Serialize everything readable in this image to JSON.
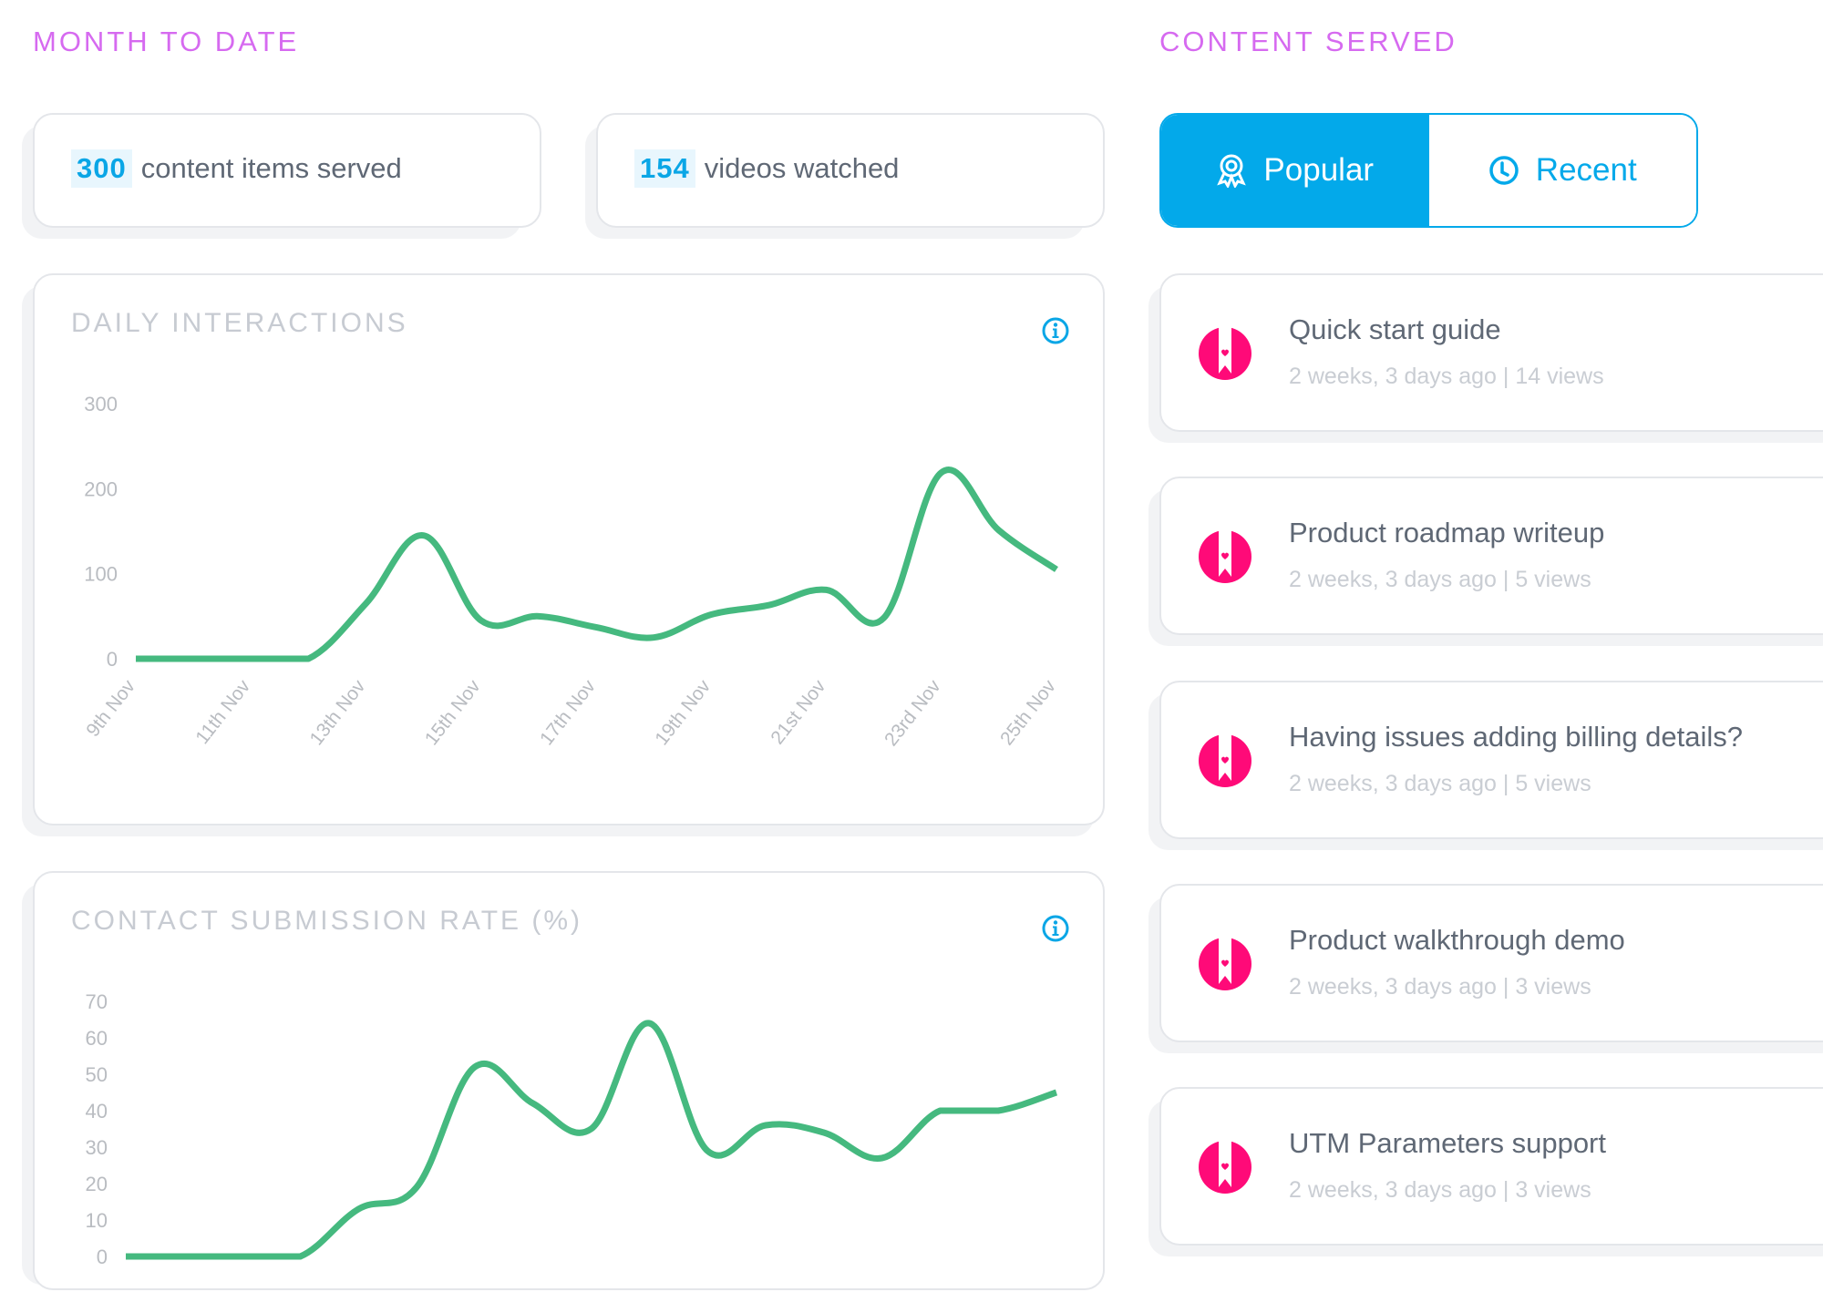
{
  "month_to_date": {
    "title": "MONTH TO DATE",
    "stats": [
      {
        "value": "300",
        "label": "content items served"
      },
      {
        "value": "154",
        "label": "videos watched"
      }
    ]
  },
  "content_served": {
    "title": "CONTENT SERVED",
    "tabs": [
      {
        "label": "Popular",
        "icon": "award-icon",
        "active": true
      },
      {
        "label": "Recent",
        "icon": "clock-icon",
        "active": false
      }
    ],
    "items": [
      {
        "title": "Quick start guide",
        "age": "2 weeks, 3 days ago",
        "views": "14 views"
      },
      {
        "title": "Product roadmap writeup",
        "age": "2 weeks, 3 days ago",
        "views": "5 views"
      },
      {
        "title": "Having issues adding billing details?",
        "age": "2 weeks, 3 days ago",
        "views": "5 views"
      },
      {
        "title": "Product walkthrough demo",
        "age": "2 weeks, 3 days ago",
        "views": "3 views"
      },
      {
        "title": "UTM Parameters support",
        "age": "2 weeks, 3 days ago",
        "views": "3 views"
      }
    ],
    "meta_separator": "|"
  },
  "colors": {
    "accent_purple": "#d66af0",
    "accent_blue": "#03a9ea",
    "line_green": "#45b97f",
    "doc_icon_pink": "#ff0a78"
  },
  "chart_data": [
    {
      "type": "line",
      "title": "DAILY INTERACTIONS",
      "xlabel": "",
      "ylabel": "",
      "x": [
        "9th Nov",
        "10th Nov",
        "11th Nov",
        "12th Nov",
        "13th Nov",
        "14th Nov",
        "15th Nov",
        "16th Nov",
        "17th Nov",
        "18th Nov",
        "19th Nov",
        "20th Nov",
        "21st Nov",
        "22nd Nov",
        "23rd Nov",
        "24th Nov",
        "25th Nov"
      ],
      "x_tick_labels": [
        "9th Nov",
        "11th Nov",
        "13th Nov",
        "15th Nov",
        "17th Nov",
        "19th Nov",
        "21st Nov",
        "23rd Nov",
        "25th Nov"
      ],
      "series": [
        {
          "name": "Interactions",
          "values": [
            0,
            0,
            0,
            0,
            65,
            145,
            45,
            50,
            37,
            25,
            52,
            63,
            81,
            48,
            219,
            151,
            105
          ]
        }
      ],
      "ylim": [
        0,
        300
      ],
      "y_ticks": [
        0,
        100,
        200,
        300
      ],
      "grid": false,
      "legend": "none",
      "smooth": true
    },
    {
      "type": "line",
      "title": "CONTACT SUBMISSION RATE (%)",
      "xlabel": "",
      "ylabel": "",
      "x": [
        "9th Nov",
        "10th Nov",
        "11th Nov",
        "12th Nov",
        "13th Nov",
        "14th Nov",
        "15th Nov",
        "16th Nov",
        "17th Nov",
        "18th Nov",
        "19th Nov",
        "20th Nov",
        "21st Nov",
        "22nd Nov",
        "23rd Nov",
        "24th Nov",
        "25th Nov"
      ],
      "series": [
        {
          "name": "Submission rate",
          "values": [
            0,
            0,
            0,
            0,
            13,
            19,
            52,
            42,
            35,
            64,
            29,
            36,
            34,
            27,
            40,
            40,
            45
          ]
        }
      ],
      "ylim": [
        0,
        70
      ],
      "y_ticks": [
        0,
        10,
        20,
        30,
        40,
        50,
        60,
        70
      ],
      "grid": false,
      "legend": "none",
      "smooth": true
    }
  ]
}
